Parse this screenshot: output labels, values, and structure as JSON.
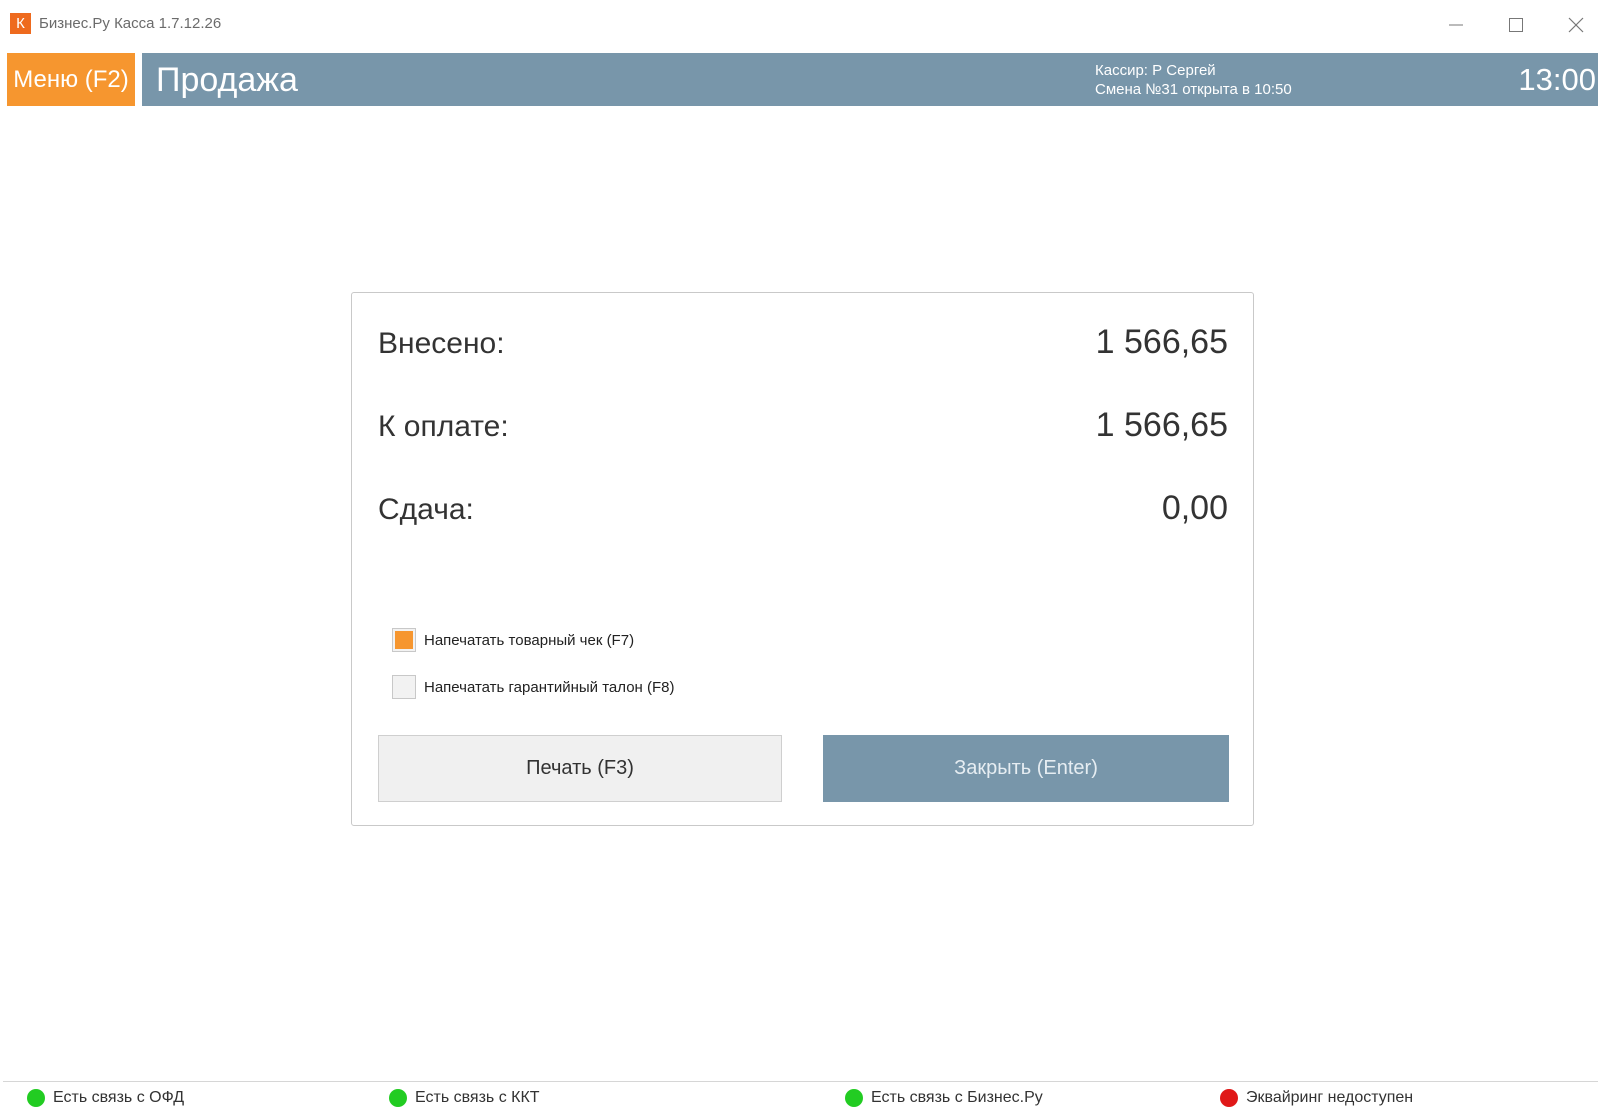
{
  "window": {
    "logo_letter": "К",
    "title": "Бизнес.Ру Касса 1.7.12.26"
  },
  "header": {
    "menu_label": "Меню (F2)",
    "page_title": "Продажа",
    "cashier": "Кассир: Р Сергей",
    "shift": "Смена №31 открыта в 10:50",
    "time": "13:00",
    "colors": {
      "menu": "#f6962f",
      "bar": "#7896aa"
    }
  },
  "payment": {
    "paid_label": "Внесено:",
    "paid_value": "1 566,65",
    "due_label": "К оплате:",
    "due_value": "1 566,65",
    "change_label": "Сдача:",
    "change_value": "0,00"
  },
  "options": [
    {
      "label": "Напечатать товарный чек (F7)",
      "checked": true
    },
    {
      "label": "Напечатать гарантийный талон (F8)",
      "checked": false
    }
  ],
  "buttons": {
    "print": "Печать (F3)",
    "close": "Закрыть (Enter)"
  },
  "status": [
    {
      "label": "Есть связь с ОФД",
      "color": "#22cc22"
    },
    {
      "label": "Есть связь с ККТ",
      "color": "#22cc22"
    },
    {
      "label": "Есть связь с Бизнес.Ру",
      "color": "#22cc22"
    },
    {
      "label": "Эквайринг недоступен",
      "color": "#e01818"
    }
  ]
}
